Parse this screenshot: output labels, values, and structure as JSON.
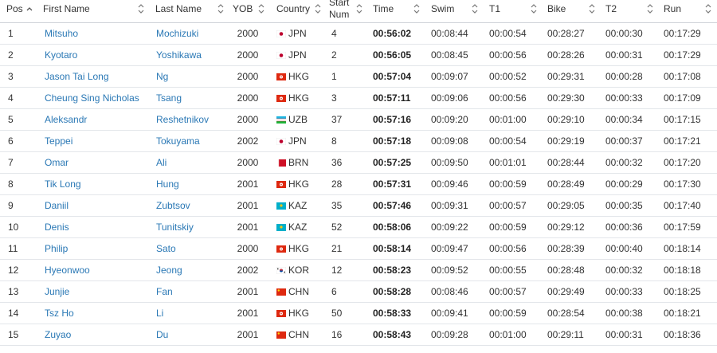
{
  "columns": [
    {
      "key": "pos",
      "label": "Pos",
      "sortable": true,
      "sorted": "asc"
    },
    {
      "key": "first",
      "label": "First Name",
      "sortable": true
    },
    {
      "key": "last",
      "label": "Last Name",
      "sortable": true
    },
    {
      "key": "yob",
      "label": "YOB",
      "sortable": true
    },
    {
      "key": "country",
      "label": "Country",
      "sortable": true
    },
    {
      "key": "start",
      "label": "Start Num",
      "sortable": true
    },
    {
      "key": "time",
      "label": "Time",
      "sortable": true
    },
    {
      "key": "swim",
      "label": "Swim",
      "sortable": true
    },
    {
      "key": "t1",
      "label": "T1",
      "sortable": true
    },
    {
      "key": "bike",
      "label": "Bike",
      "sortable": true
    },
    {
      "key": "t2",
      "label": "T2",
      "sortable": true
    },
    {
      "key": "run",
      "label": "Run",
      "sortable": true
    }
  ],
  "rows": [
    {
      "pos": "1",
      "first": "Mitsuho",
      "last": "Mochizuki",
      "yob": "2000",
      "country": "JPN",
      "start": "4",
      "time": "00:56:02",
      "swim": "00:08:44",
      "t1": "00:00:54",
      "bike": "00:28:27",
      "t2": "00:00:30",
      "run": "00:17:29"
    },
    {
      "pos": "2",
      "first": "Kyotaro",
      "last": "Yoshikawa",
      "yob": "2000",
      "country": "JPN",
      "start": "2",
      "time": "00:56:05",
      "swim": "00:08:45",
      "t1": "00:00:56",
      "bike": "00:28:26",
      "t2": "00:00:31",
      "run": "00:17:29"
    },
    {
      "pos": "3",
      "first": "Jason Tai Long",
      "last": "Ng",
      "yob": "2000",
      "country": "HKG",
      "start": "1",
      "time": "00:57:04",
      "swim": "00:09:07",
      "t1": "00:00:52",
      "bike": "00:29:31",
      "t2": "00:00:28",
      "run": "00:17:08"
    },
    {
      "pos": "4",
      "first": "Cheung Sing Nicholas",
      "last": "Tsang",
      "yob": "2000",
      "country": "HKG",
      "start": "3",
      "time": "00:57:11",
      "swim": "00:09:06",
      "t1": "00:00:56",
      "bike": "00:29:30",
      "t2": "00:00:33",
      "run": "00:17:09"
    },
    {
      "pos": "5",
      "first": "Aleksandr",
      "last": "Reshetnikov",
      "yob": "2000",
      "country": "UZB",
      "start": "37",
      "time": "00:57:16",
      "swim": "00:09:20",
      "t1": "00:01:00",
      "bike": "00:29:10",
      "t2": "00:00:34",
      "run": "00:17:15"
    },
    {
      "pos": "6",
      "first": "Teppei",
      "last": "Tokuyama",
      "yob": "2002",
      "country": "JPN",
      "start": "8",
      "time": "00:57:18",
      "swim": "00:09:08",
      "t1": "00:00:54",
      "bike": "00:29:19",
      "t2": "00:00:37",
      "run": "00:17:21"
    },
    {
      "pos": "7",
      "first": "Omar",
      "last": "Ali",
      "yob": "2000",
      "country": "BRN",
      "start": "36",
      "time": "00:57:25",
      "swim": "00:09:50",
      "t1": "00:01:01",
      "bike": "00:28:44",
      "t2": "00:00:32",
      "run": "00:17:20"
    },
    {
      "pos": "8",
      "first": "Tik Long",
      "last": "Hung",
      "yob": "2001",
      "country": "HKG",
      "start": "28",
      "time": "00:57:31",
      "swim": "00:09:46",
      "t1": "00:00:59",
      "bike": "00:28:49",
      "t2": "00:00:29",
      "run": "00:17:30"
    },
    {
      "pos": "9",
      "first": "Daniil",
      "last": "Zubtsov",
      "yob": "2001",
      "country": "KAZ",
      "start": "35",
      "time": "00:57:46",
      "swim": "00:09:31",
      "t1": "00:00:57",
      "bike": "00:29:05",
      "t2": "00:00:35",
      "run": "00:17:40"
    },
    {
      "pos": "10",
      "first": "Denis",
      "last": "Tunitskiy",
      "yob": "2001",
      "country": "KAZ",
      "start": "52",
      "time": "00:58:06",
      "swim": "00:09:22",
      "t1": "00:00:59",
      "bike": "00:29:12",
      "t2": "00:00:36",
      "run": "00:17:59"
    },
    {
      "pos": "11",
      "first": "Philip",
      "last": "Sato",
      "yob": "2000",
      "country": "HKG",
      "start": "21",
      "time": "00:58:14",
      "swim": "00:09:47",
      "t1": "00:00:56",
      "bike": "00:28:39",
      "t2": "00:00:40",
      "run": "00:18:14"
    },
    {
      "pos": "12",
      "first": "Hyeonwoo",
      "last": "Jeong",
      "yob": "2002",
      "country": "KOR",
      "start": "12",
      "time": "00:58:23",
      "swim": "00:09:52",
      "t1": "00:00:55",
      "bike": "00:28:48",
      "t2": "00:00:32",
      "run": "00:18:18"
    },
    {
      "pos": "13",
      "first": "Junjie",
      "last": "Fan",
      "yob": "2001",
      "country": "CHN",
      "start": "6",
      "time": "00:58:28",
      "swim": "00:08:46",
      "t1": "00:00:57",
      "bike": "00:29:49",
      "t2": "00:00:33",
      "run": "00:18:25"
    },
    {
      "pos": "14",
      "first": "Tsz Ho",
      "last": "Li",
      "yob": "2001",
      "country": "HKG",
      "start": "50",
      "time": "00:58:33",
      "swim": "00:09:41",
      "t1": "00:00:59",
      "bike": "00:28:54",
      "t2": "00:00:38",
      "run": "00:18:21"
    },
    {
      "pos": "15",
      "first": "Zuyao",
      "last": "Du",
      "yob": "2001",
      "country": "CHN",
      "start": "16",
      "time": "00:58:43",
      "swim": "00:09:28",
      "t1": "00:01:00",
      "bike": "00:29:11",
      "t2": "00:00:31",
      "run": "00:18:36"
    }
  ],
  "colors": {
    "link": "#2a78b5",
    "border": "#e3e6ea",
    "header_border": "#cfd3d8"
  }
}
